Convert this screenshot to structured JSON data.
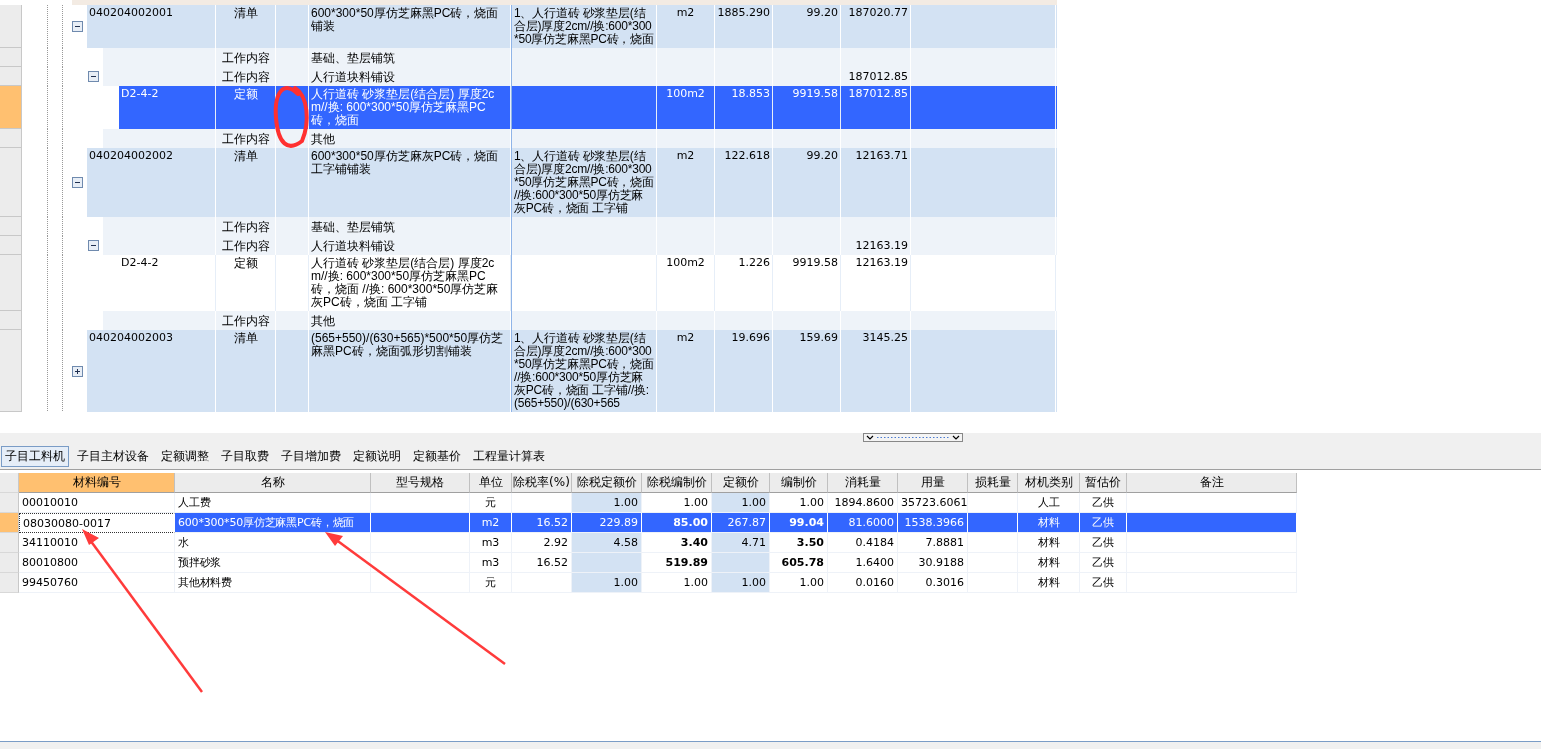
{
  "bill_items": [
    {
      "kind": "bill",
      "code": "040204002001",
      "type": "清单",
      "name": "600*300*50厚仿芝麻黑PC砖，烧面铺装",
      "feature": "1、人行道砖 砂浆垫层(结合层)厚度2cm//换:600*300*50厚仿芝麻黑PC砖，烧面",
      "unit": "m2",
      "qty": "1885.290",
      "price": "99.20",
      "total": "187020.77",
      "selected": false,
      "expanded": true,
      "children": [
        {
          "kind": "work",
          "type": "工作内容",
          "name": "基础、垫层铺筑",
          "selected": false
        },
        {
          "kind": "work",
          "type": "工作内容",
          "name": "人行道块料铺设",
          "total": "187012.85",
          "selected": false,
          "expanded": true,
          "children": [
            {
              "kind": "quota",
              "code": "D2-4-2",
              "type": "定额",
              "name": "人行道砖 砂浆垫层(结合层) 厚度2cm//换: 600*300*50厚仿芝麻黑PC砖，烧面",
              "unit": "100m2",
              "qty": "18.853",
              "price": "9919.58",
              "total": "187012.85",
              "selected": true
            }
          ]
        },
        {
          "kind": "work",
          "type": "工作内容",
          "name": "其他",
          "selected": false
        }
      ]
    },
    {
      "kind": "bill",
      "code": "040204002002",
      "type": "清单",
      "name": "600*300*50厚仿芝麻灰PC砖，烧面工字铺铺装",
      "feature": "1、人行道砖 砂浆垫层(结合层)厚度2cm//换:600*300*50厚仿芝麻黑PC砖，烧面 //换:600*300*50厚仿芝麻灰PC砖，烧面 工字铺",
      "unit": "m2",
      "qty": "122.618",
      "price": "99.20",
      "total": "12163.71",
      "selected": false,
      "expanded": true,
      "children": [
        {
          "kind": "work",
          "type": "工作内容",
          "name": "基础、垫层铺筑",
          "selected": false
        },
        {
          "kind": "work",
          "type": "工作内容",
          "name": "人行道块料铺设",
          "total": "12163.19",
          "selected": false,
          "expanded": true,
          "children": [
            {
              "kind": "quota",
              "code": "D2-4-2",
              "type": "定额",
              "name": "人行道砖 砂浆垫层(结合层) 厚度2cm//换: 600*300*50厚仿芝麻黑PC砖，烧面 //换: 600*300*50厚仿芝麻灰PC砖，烧面 工字铺",
              "unit": "100m2",
              "qty": "1.226",
              "price": "9919.58",
              "total": "12163.19",
              "selected": false
            }
          ]
        },
        {
          "kind": "work",
          "type": "工作内容",
          "name": "其他",
          "selected": false
        }
      ]
    },
    {
      "kind": "bill",
      "code": "040204002003",
      "type": "清单",
      "name": "(565+550)/(630+565)*500*50厚仿芝麻黑PC砖，烧面弧形切割铺装",
      "feature": "1、人行道砖 砂浆垫层(结合层)厚度2cm//换:600*300*50厚仿芝麻黑PC砖，烧面 //换:600*300*50厚仿芝麻灰PC砖，烧面 工字铺//换:(565+550)/(630+565",
      "unit": "m2",
      "qty": "19.696",
      "price": "159.69",
      "total": "3145.25",
      "selected": false,
      "expanded": false
    }
  ],
  "detail_tabs": [
    {
      "label": "子目工料机",
      "selected": true
    },
    {
      "label": "子目主材设备",
      "selected": false
    },
    {
      "label": "定额调整",
      "selected": false
    },
    {
      "label": "子目取费",
      "selected": false
    },
    {
      "label": "子目增加费",
      "selected": false
    },
    {
      "label": "定额说明",
      "selected": false
    },
    {
      "label": "定额基价",
      "selected": false
    },
    {
      "label": "工程量计算表",
      "selected": false
    }
  ],
  "material_columns": [
    {
      "label": "材料编号",
      "selected": true
    },
    {
      "label": "名称",
      "selected": false
    },
    {
      "label": "型号规格",
      "selected": false
    },
    {
      "label": "单位",
      "selected": false
    },
    {
      "label": "除税率(%)",
      "selected": false
    },
    {
      "label": "除税定额价",
      "selected": false
    },
    {
      "label": "除税编制价",
      "selected": false
    },
    {
      "label": "定额价",
      "selected": false
    },
    {
      "label": "编制价",
      "selected": false
    },
    {
      "label": "消耗量",
      "selected": false
    },
    {
      "label": "用量",
      "selected": false
    },
    {
      "label": "损耗量",
      "selected": false
    },
    {
      "label": "材机类别",
      "selected": false
    },
    {
      "label": "暂估价",
      "selected": false
    },
    {
      "label": "备注",
      "selected": false
    }
  ],
  "materials": [
    {
      "code": "00010010",
      "name": "人工费",
      "unit": "元",
      "base_price_ex": "1.00",
      "price_ex": "1.00",
      "base_price": "1.00",
      "price": "1.00",
      "consumption": "1894.8600",
      "usage": "35723.6061",
      "category": "人工",
      "estimate": "乙供",
      "adjusted": false,
      "selected": false
    },
    {
      "code": "08030080-0017",
      "name": "600*300*50厚仿芝麻黑PC砖，烧面",
      "unit": "m2",
      "tax_rate": "16.52",
      "base_price_ex": "229.89",
      "price_ex": "85.00",
      "base_price": "267.87",
      "price": "99.04",
      "consumption": "81.6000",
      "usage": "1538.3966",
      "category": "材料",
      "estimate": "乙供",
      "adjusted": true,
      "selected": true
    },
    {
      "code": "34110010",
      "name": "水",
      "unit": "m3",
      "tax_rate": "2.92",
      "base_price_ex": "4.58",
      "price_ex": "3.40",
      "base_price": "4.71",
      "price": "3.50",
      "consumption": "0.4184",
      "usage": "7.8881",
      "category": "材料",
      "estimate": "乙供",
      "adjusted": true,
      "selected": false
    },
    {
      "code": "80010800",
      "name": "预拌砂浆",
      "unit": "m3",
      "tax_rate": "16.52",
      "price_ex": "519.89",
      "price": "605.78",
      "consumption": "1.6400",
      "usage": "30.9188",
      "category": "材料",
      "estimate": "乙供",
      "adjusted": true,
      "selected": false
    },
    {
      "code": "99450760",
      "name": "其他材料费",
      "unit": "元",
      "base_price_ex": "1.00",
      "price_ex": "1.00",
      "base_price": "1.00",
      "price": "1.00",
      "consumption": "0.0160",
      "usage": "0.3016",
      "category": "材料",
      "estimate": "乙供",
      "adjusted": false,
      "selected": false
    }
  ]
}
